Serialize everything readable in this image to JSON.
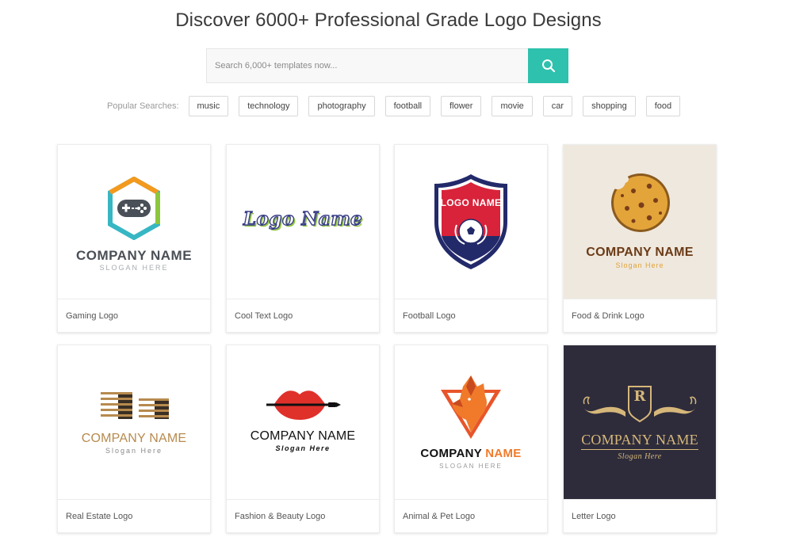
{
  "header": {
    "title": "Discover 6000+ Professional Grade Logo Designs"
  },
  "search": {
    "placeholder": "Search 6,000+ templates now...",
    "icon": "search-icon"
  },
  "popular": {
    "label": "Popular Searches:",
    "tags": [
      "music",
      "technology",
      "photography",
      "football",
      "flower",
      "movie",
      "car",
      "shopping",
      "food"
    ]
  },
  "colors": {
    "accent": "#2ec1ad",
    "food_bg": "#efe8de",
    "letter_bg": "#2e2c3b",
    "gold": "#d6b77a",
    "football_red": "#d8233a",
    "football_navy": "#232a6a",
    "fox_orange": "#f07a2a"
  },
  "cards": [
    {
      "label": "Gaming Logo",
      "company": "COMPANY NAME",
      "slogan": "SLOGAN HERE"
    },
    {
      "label": "Cool Text Logo",
      "logo_text": "Logo Name"
    },
    {
      "label": "Football Logo",
      "logo_text": "LOGO NAME"
    },
    {
      "label": "Food & Drink Logo",
      "company": "COMPANY NAME",
      "slogan": "Slogan Here"
    },
    {
      "label": "Real Estate Logo",
      "company": "COMPANY NAME",
      "slogan": "Slogan Here"
    },
    {
      "label": "Fashion & Beauty Logo",
      "company": "COMPANY NAME",
      "slogan": "Slogan Here"
    },
    {
      "label": "Animal & Pet Logo",
      "company_a": "COMPANY",
      "company_b": "NAME",
      "slogan": "SLOGAN HERE"
    },
    {
      "label": "Letter Logo",
      "letter": "R",
      "company": "COMPANY NAME",
      "slogan": "Slogan Here"
    }
  ]
}
